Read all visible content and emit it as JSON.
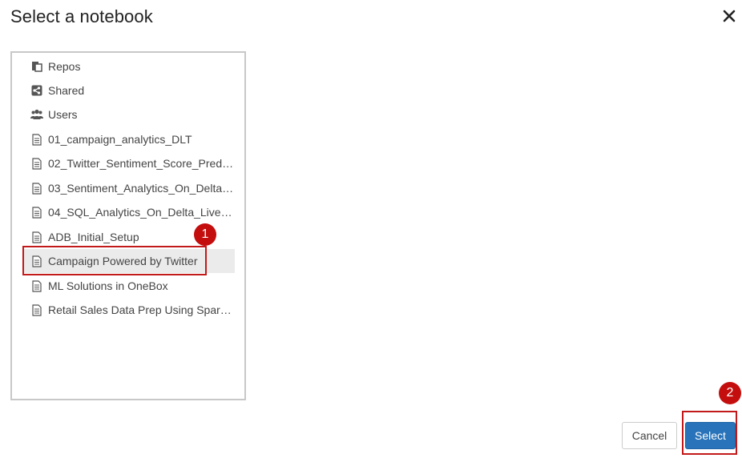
{
  "dialog": {
    "title": "Select a notebook",
    "close_icon": "close-icon"
  },
  "tree": {
    "items": [
      {
        "label": "Repos",
        "icon": "repos-icon"
      },
      {
        "label": "Shared",
        "icon": "shared-icon"
      },
      {
        "label": "Users",
        "icon": "users-icon"
      },
      {
        "label": "01_campaign_analytics_DLT",
        "icon": "notebook-icon"
      },
      {
        "label": "02_Twitter_Sentiment_Score_Pred_...",
        "icon": "notebook-icon"
      },
      {
        "label": "03_Sentiment_Analytics_On_Delta_...",
        "icon": "notebook-icon"
      },
      {
        "label": "04_SQL_Analytics_On_Delta_Live_T...",
        "icon": "notebook-icon"
      },
      {
        "label": "ADB_Initial_Setup",
        "icon": "notebook-icon"
      },
      {
        "label": "Campaign Powered by Twitter",
        "icon": "notebook-icon",
        "selected": true
      },
      {
        "label": "ML Solutions in OneBox",
        "icon": "notebook-icon"
      },
      {
        "label": "Retail Sales Data Prep Using Spark ...",
        "icon": "notebook-icon"
      }
    ]
  },
  "annotations": {
    "marker_1": "1",
    "marker_2": "2",
    "color": "#c40e0e"
  },
  "footer": {
    "cancel_label": "Cancel",
    "select_label": "Select",
    "primary_color": "#2873b9"
  }
}
